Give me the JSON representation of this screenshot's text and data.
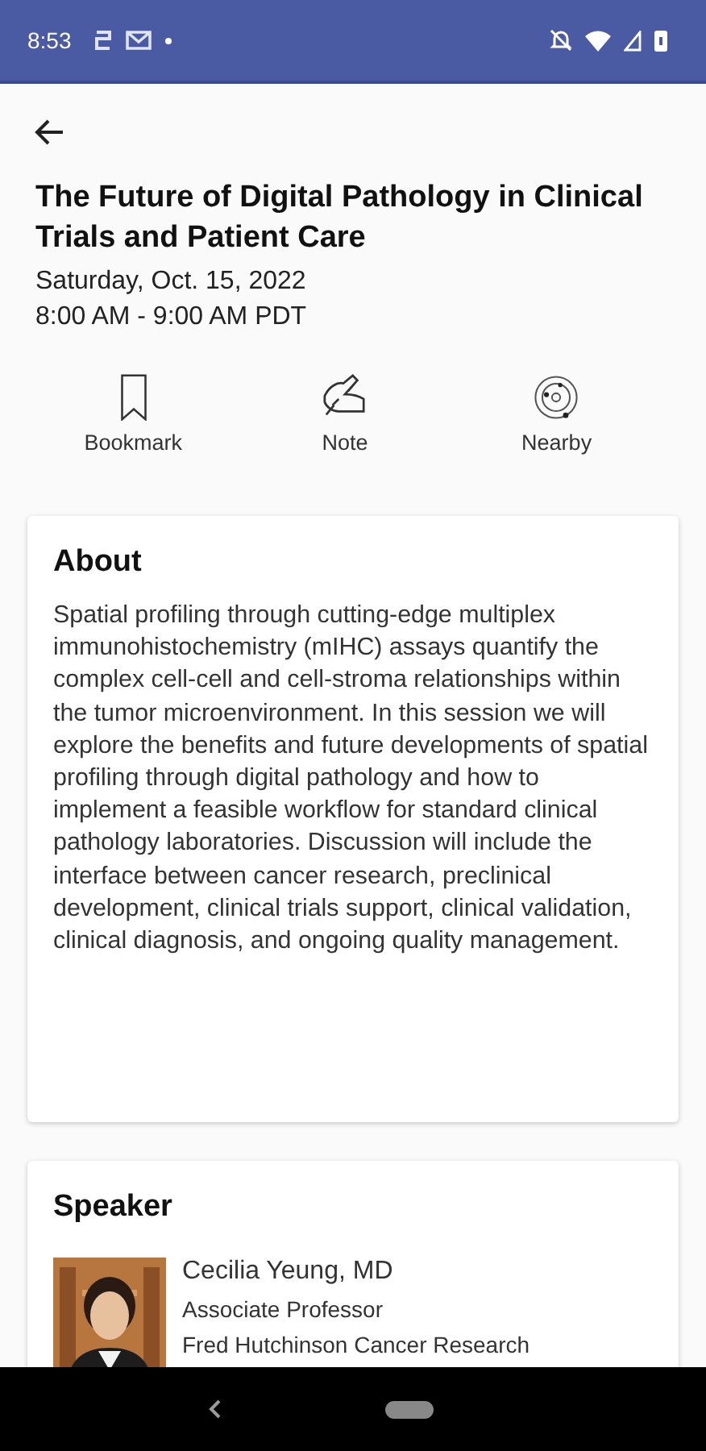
{
  "status_bar": {
    "time": "8:53"
  },
  "session": {
    "title": "The Future of Digital Pathology in Clinical Trials and Patient Care",
    "date": "Saturday, Oct. 15, 2022",
    "time": "8:00 AM - 9:00 AM PDT"
  },
  "actions": [
    {
      "kind": "bookmark",
      "label": "Bookmark"
    },
    {
      "kind": "note",
      "label": "Note"
    },
    {
      "kind": "nearby",
      "label": "Nearby"
    }
  ],
  "about": {
    "heading": "About",
    "text": "Spatial profiling through cutting-edge multiplex immunohistochemistry (mIHC) assays quantify the complex cell-cell and cell-stroma relationships within the tumor microenvironment. In this session we will explore the benefits and future developments of spatial profiling through digital pathology and how to implement a feasible workflow for standard clinical pathology laboratories. Discussion will include the interface between cancer research, preclinical development, clinical trials support, clinical validation, clinical diagnosis, and ongoing quality management."
  },
  "speaker": {
    "heading": "Speaker",
    "name": "Cecilia Yeung, MD",
    "role": "Associate Professor",
    "organization": "Fred Hutchinson Cancer Research"
  }
}
